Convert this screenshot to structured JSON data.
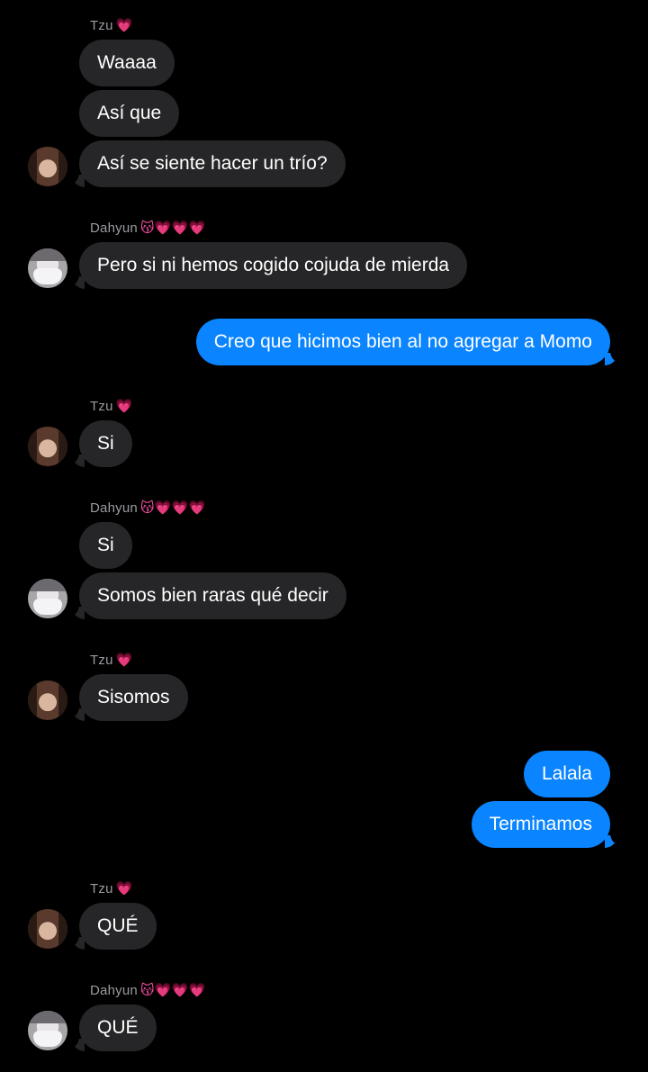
{
  "colors": {
    "background": "#000000",
    "incoming_bubble": "#262628",
    "outgoing_bubble": "#0a84ff",
    "sender_name": "#9a9aa0",
    "heart": "#ff4fa6"
  },
  "senders": {
    "tzu": {
      "name": "Tzu",
      "emojis": "💗"
    },
    "dahyun": {
      "name": "Dahyun",
      "emojis": "😽💗💗💗"
    }
  },
  "messages": {
    "m1": "Waaaa",
    "m2": "Así que",
    "m3": "Así se siente hacer un trío?",
    "m4": "Pero si ni hemos cogido cojuda de mierda",
    "m5": "Creo que hicimos bien al no agregar a Momo",
    "m6": "Si",
    "m7": "Si",
    "m8": "Somos bien raras qué decir",
    "m9": "Sisomos",
    "m10": "Lalala",
    "m11": "Terminamos",
    "m12": "QUÉ",
    "m13": "QUÉ"
  }
}
